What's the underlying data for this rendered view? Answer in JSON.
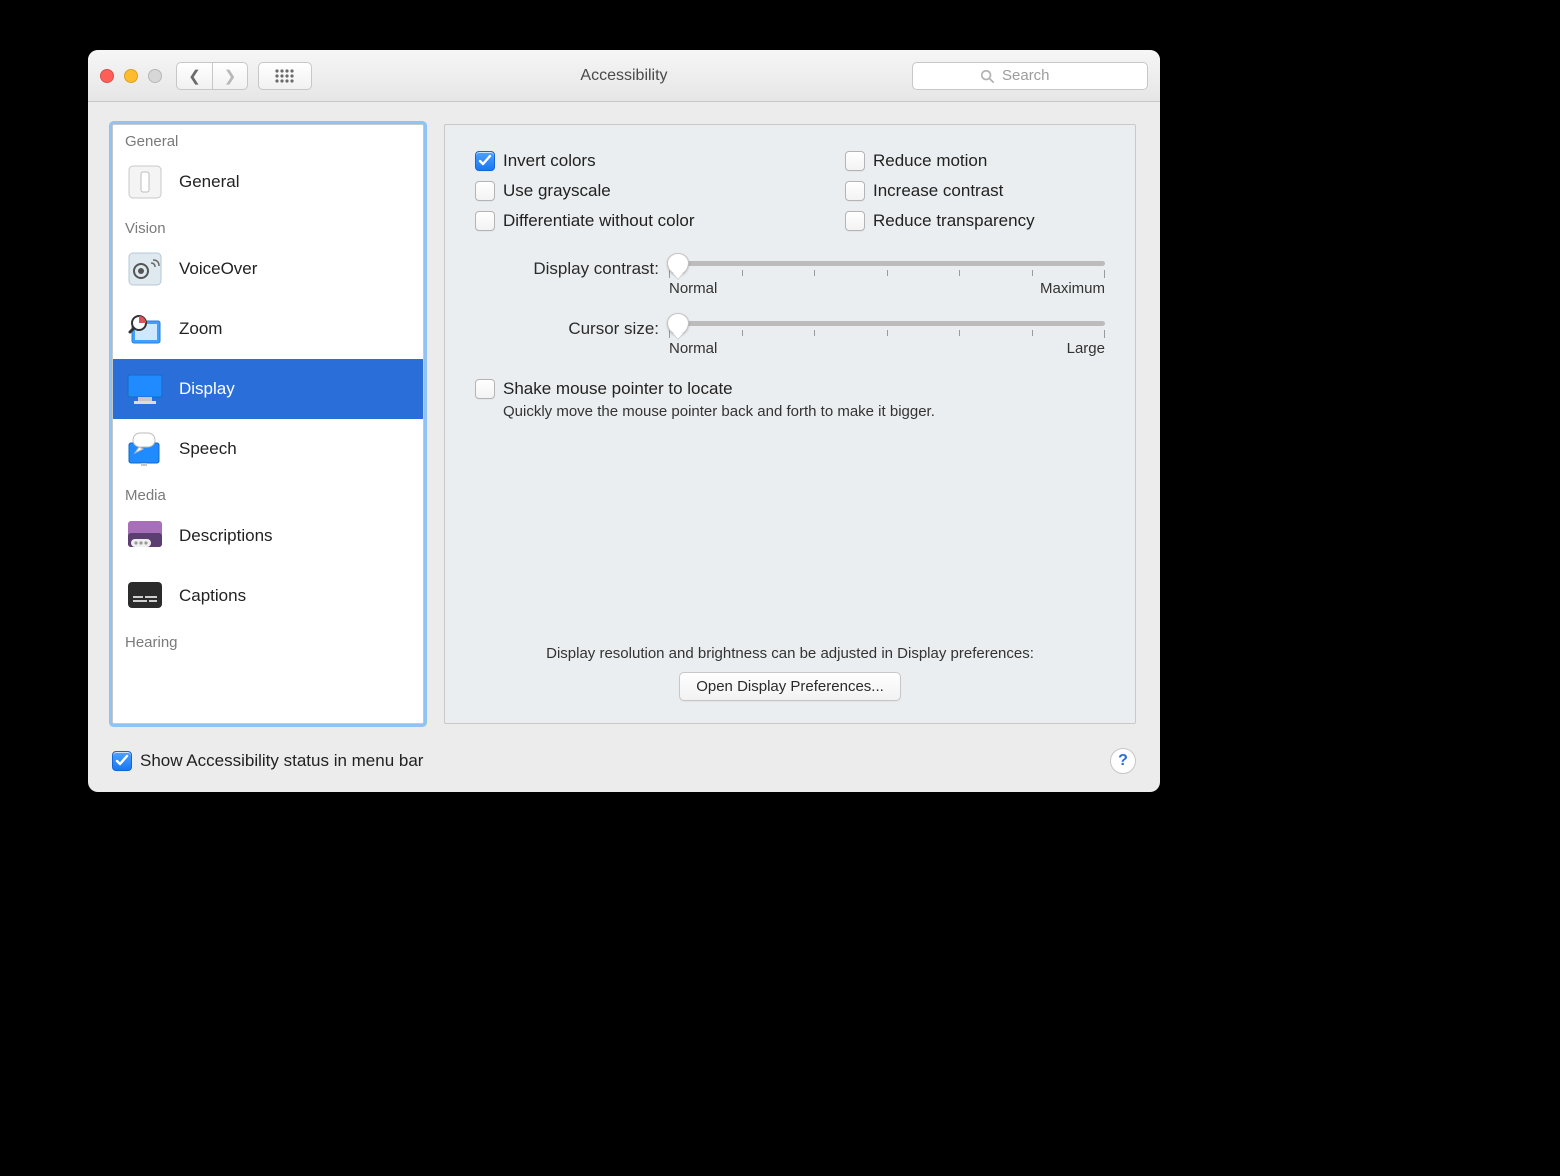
{
  "window": {
    "title": "Accessibility"
  },
  "toolbar": {
    "search_placeholder": "Search"
  },
  "sidebar": {
    "groups": {
      "general": "General",
      "vision": "Vision",
      "media": "Media",
      "hearing": "Hearing"
    },
    "items": {
      "general": "General",
      "voiceover": "VoiceOver",
      "zoom": "Zoom",
      "display": "Display",
      "speech": "Speech",
      "descriptions": "Descriptions",
      "captions": "Captions"
    },
    "selected": "display"
  },
  "options": {
    "invert_colors": {
      "label": "Invert colors",
      "checked": true
    },
    "use_grayscale": {
      "label": "Use grayscale",
      "checked": false
    },
    "differentiate_without_color": {
      "label": "Differentiate without color",
      "checked": false
    },
    "reduce_motion": {
      "label": "Reduce motion",
      "checked": false
    },
    "increase_contrast": {
      "label": "Increase contrast",
      "checked": false
    },
    "reduce_transparency": {
      "label": "Reduce transparency",
      "checked": false
    }
  },
  "sliders": {
    "display_contrast": {
      "label": "Display contrast:",
      "min_label": "Normal",
      "max_label": "Maximum",
      "value_percent": 2
    },
    "cursor_size": {
      "label": "Cursor size:",
      "min_label": "Normal",
      "max_label": "Large",
      "value_percent": 2
    }
  },
  "shake": {
    "label": "Shake mouse pointer to locate",
    "checked": false,
    "description": "Quickly move the mouse pointer back and forth to make it bigger."
  },
  "footer": {
    "note": "Display resolution and brightness can be adjusted in Display preferences:",
    "button": "Open Display Preferences...",
    "show_status": {
      "label": "Show Accessibility status in menu bar",
      "checked": true
    }
  }
}
